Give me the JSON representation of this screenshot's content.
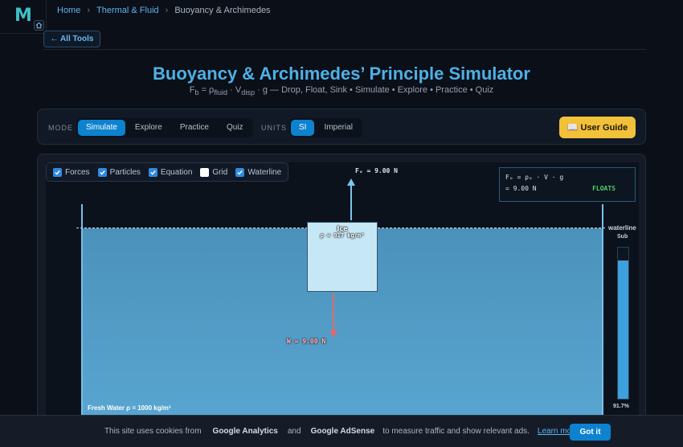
{
  "logo": "M",
  "breadcrumb": {
    "home": "Home",
    "category": "Thermal & Fluid",
    "current": "Buoyancy & Archimedes",
    "sep": "›"
  },
  "all_tools": "← All Tools",
  "title": "Buoyancy & Archimedes’ Principle Simulator",
  "subtitle": {
    "formula_fb": "F",
    "fb_sub": "b",
    "eq": " = ρ",
    "rho_sub": "fluid",
    "dot_v": " · V",
    "v_sub": "disp",
    "rest": " · g — Drop, Float, Sink • Simulate • Explore • Practice • Quiz"
  },
  "toolbar": {
    "mode_label": "MODE",
    "modes": [
      "Simulate",
      "Explore",
      "Practice",
      "Quiz"
    ],
    "units_label": "UNITS",
    "units": [
      "SI",
      "Imperial"
    ],
    "guide_icon": "📖",
    "guide_label": "User Guide"
  },
  "toggles": [
    "Forces",
    "Particles",
    "Equation",
    "Grid",
    "Waterline"
  ],
  "toggle_states": [
    true,
    true,
    true,
    false,
    true
  ],
  "equation": {
    "line1": "Fₒ = ρₒ · V · g",
    "line2": "= 9.00 N",
    "status": "FLOATS"
  },
  "buoyant_label": "Fₒ = 9.00 N",
  "weight_label": "W = 9.00 N",
  "block": {
    "name": "Ice",
    "density": "ρ = 917 kg/m³"
  },
  "waterline_label": "waterline",
  "fluid_label": "Fresh Water  ρ = 1000 kg/m³",
  "submerged": {
    "label": "Sub",
    "percent_text": "91.7%",
    "fraction": 0.917
  },
  "cookie": {
    "prefix": "This site uses cookies from",
    "ga": "Google Analytics",
    "and": "and",
    "adsense": "Google AdSense",
    "suffix": "to measure traffic and show relevant ads.",
    "learn_more": "Learn more",
    "got_it": "Got it"
  },
  "colors": {
    "accent": "#0d82cf",
    "title": "#4eb0e6",
    "guide": "#f2c13a",
    "floats": "#4ed06a"
  }
}
